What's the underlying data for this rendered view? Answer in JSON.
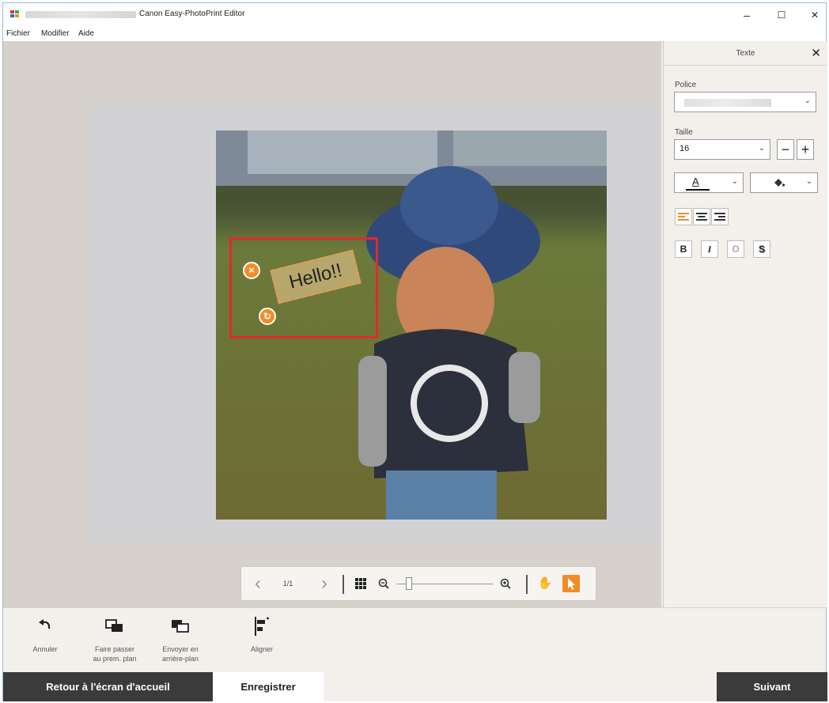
{
  "window": {
    "title": "Canon Easy-PhotoPrint Editor",
    "controls": {
      "minimize": "–",
      "maximize": "☐",
      "close": "✕"
    }
  },
  "menu": {
    "items": [
      "Fichier",
      "Modifier",
      "Aide"
    ]
  },
  "canvas": {
    "text_label": "Hello!!",
    "selection_color": "#e12a2a",
    "handle_color": "#f28c28"
  },
  "nav_toolbar": {
    "prev": "‹",
    "page_indicator": "1/1",
    "next": "›",
    "zoom_level_fraction": 0.0
  },
  "panel": {
    "title": "Texte",
    "close": "✕",
    "font_label": "Police",
    "size_label": "Taille",
    "size_value": "16",
    "decrease": "−",
    "increase": "+",
    "text_color_glyph": "A",
    "bold": "B",
    "italic": "I",
    "outline": "O",
    "shadow": "S"
  },
  "commands": {
    "undo": "Annuler",
    "bring_front_line1": "Faire passer",
    "bring_front_line2": "au prem. plan",
    "send_back_line1": "Envoyer en",
    "send_back_line2": "arrière-plan",
    "align": "Aligner"
  },
  "footer": {
    "home": "Retour à l'écran d'accueil",
    "save": "Enregistrer",
    "next": "Suivant"
  },
  "colors": {
    "accent": "#f28c28",
    "footer_dark": "#3b3b3b"
  }
}
